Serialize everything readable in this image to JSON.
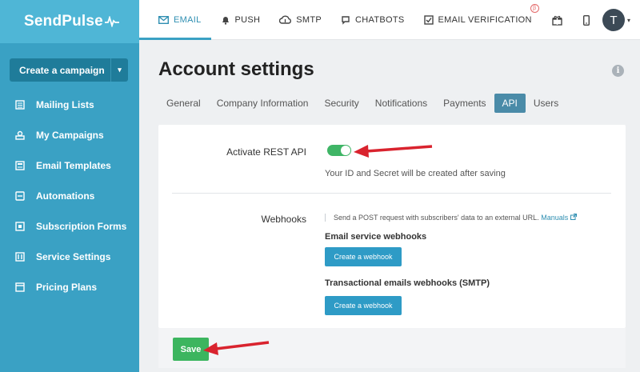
{
  "brand": {
    "name": "SendPulse"
  },
  "sidebar": {
    "create_label": "Create a campaign",
    "items": [
      {
        "label": "Mailing Lists",
        "icon": "list-icon"
      },
      {
        "label": "My Campaigns",
        "icon": "campaign-icon"
      },
      {
        "label": "Email Templates",
        "icon": "template-icon"
      },
      {
        "label": "Automations",
        "icon": "automation-icon"
      },
      {
        "label": "Subscription Forms",
        "icon": "form-icon"
      },
      {
        "label": "Service Settings",
        "icon": "settings-icon"
      },
      {
        "label": "Pricing Plans",
        "icon": "pricing-icon"
      }
    ]
  },
  "topnav": {
    "tabs": [
      {
        "label": "EMAIL",
        "icon": "mail-icon",
        "active": true
      },
      {
        "label": "PUSH",
        "icon": "bell-icon"
      },
      {
        "label": "SMTP",
        "icon": "cloud-icon"
      },
      {
        "label": "CHATBOTS",
        "icon": "chat-icon"
      },
      {
        "label": "EMAIL VERIFICATION",
        "icon": "checkbox-icon",
        "badge": "β"
      }
    ],
    "avatar_initial": "T"
  },
  "page": {
    "title": "Account settings",
    "tabs": [
      {
        "label": "General"
      },
      {
        "label": "Company Information"
      },
      {
        "label": "Security"
      },
      {
        "label": "Notifications"
      },
      {
        "label": "Payments"
      },
      {
        "label": "API",
        "active": true
      },
      {
        "label": "Users"
      }
    ]
  },
  "api": {
    "rest_label": "Activate REST API",
    "rest_enabled": true,
    "rest_hint": "Your ID and Secret will be created after saving",
    "webhooks_label": "Webhooks",
    "webhooks_desc": "Send a POST request with subscribers' data to an external URL.",
    "manuals_link": "Manuals",
    "email_service_title": "Email service webhooks",
    "transactional_title": "Transactional emails webhooks (SMTP)",
    "create_webhook_label": "Create a webhook",
    "save_label": "Save"
  },
  "colors": {
    "sidebar": "#3aa1c4",
    "accent": "#2e9bc6",
    "toggle_on": "#3fb566",
    "save": "#3cb55f",
    "annotation_arrow": "#d9232e"
  }
}
